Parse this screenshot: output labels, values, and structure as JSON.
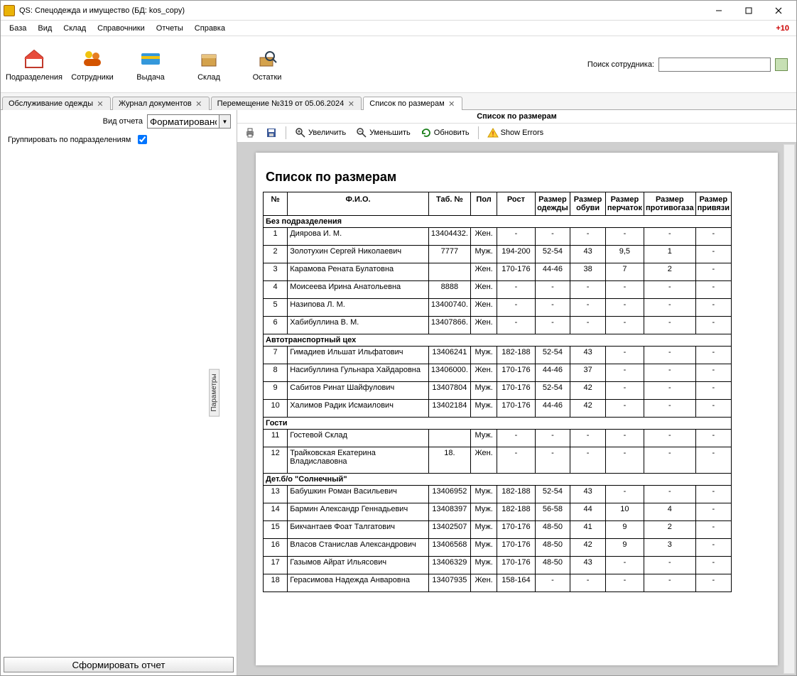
{
  "window": {
    "title": "QS: Спецодежда и имущество (БД: kos_copy)"
  },
  "menu": {
    "items": [
      "База",
      "Вид",
      "Склад",
      "Справочники",
      "Отчеты",
      "Справка"
    ],
    "right_status": "+10"
  },
  "main_toolbar": {
    "buttons": [
      {
        "name": "departments-button",
        "label": "Подразделения"
      },
      {
        "name": "employees-button",
        "label": "Сотрудники"
      },
      {
        "name": "issue-button",
        "label": "Выдача"
      },
      {
        "name": "stock-button",
        "label": "Склад"
      },
      {
        "name": "remains-button",
        "label": "Остатки"
      }
    ],
    "search_label": "Поиск сотрудника:"
  },
  "tabs": [
    {
      "label": "Обслуживание одежды",
      "active": false
    },
    {
      "label": "Журнал документов",
      "active": false
    },
    {
      "label": "Перемещение №319 от 05.06.2024",
      "active": false
    },
    {
      "label": "Список по размерам",
      "active": true
    }
  ],
  "left": {
    "report_type_label": "Вид отчета",
    "report_type_value": "Форматировано",
    "group_by_dept_label": "Группировать по подразделениям",
    "group_by_dept_checked": true,
    "params_handle": "Параметры",
    "run_button": "Сформировать отчет"
  },
  "report_toolbar": {
    "title": "Список по размерам",
    "zoom_in": "Увеличить",
    "zoom_out": "Уменьшить",
    "refresh": "Обновить",
    "show_errors": "Show Errors"
  },
  "report": {
    "heading": "Список по размерам",
    "columns": [
      "№",
      "Ф.И.О.",
      "Таб. №",
      "Пол",
      "Рост",
      "Размер одежды",
      "Размер обуви",
      "Размер перчаток",
      "Размер противогаза",
      "Размер привязи"
    ],
    "groups": [
      {
        "name": "Без подразделения",
        "rows": [
          {
            "n": "1",
            "fio": "Диярова И. М.",
            "tab": "13404432.",
            "sex": "Жен.",
            "height": "-",
            "cloth": "-",
            "shoe": "-",
            "glove": "-",
            "mask": "-",
            "harness": "-"
          },
          {
            "n": "2",
            "fio": "Золотухин Сергей Николаевич",
            "tab": "7777",
            "sex": "Муж.",
            "height": "194-200",
            "cloth": "52-54",
            "shoe": "43",
            "glove": "9,5",
            "mask": "1",
            "harness": "-"
          },
          {
            "n": "3",
            "fio": "Карамова Рената Булатовна",
            "tab": "",
            "sex": "Жен.",
            "height": "170-176",
            "cloth": "44-46",
            "shoe": "38",
            "glove": "7",
            "mask": "2",
            "harness": "-"
          },
          {
            "n": "4",
            "fio": "Моисеева Ирина Анатольевна",
            "tab": "8888",
            "sex": "Жен.",
            "height": "-",
            "cloth": "-",
            "shoe": "-",
            "glove": "-",
            "mask": "-",
            "harness": "-"
          },
          {
            "n": "5",
            "fio": "Назипова Л. М.",
            "tab": "13400740.",
            "sex": "Жен.",
            "height": "-",
            "cloth": "-",
            "shoe": "-",
            "glove": "-",
            "mask": "-",
            "harness": "-"
          },
          {
            "n": "6",
            "fio": "Хабибуллина В. М.",
            "tab": "13407866.",
            "sex": "Жен.",
            "height": "-",
            "cloth": "-",
            "shoe": "-",
            "glove": "-",
            "mask": "-",
            "harness": "-"
          }
        ]
      },
      {
        "name": "Автотранспортный цех",
        "rows": [
          {
            "n": "7",
            "fio": "Гимадиев Ильшат Ильфатович",
            "tab": "13406241",
            "sex": "Муж.",
            "height": "182-188",
            "cloth": "52-54",
            "shoe": "43",
            "glove": "-",
            "mask": "-",
            "harness": "-"
          },
          {
            "n": "8",
            "fio": "Насибуллина Гульнара Хайдаровна",
            "tab": "13406000.",
            "sex": "Жен.",
            "height": "170-176",
            "cloth": "44-46",
            "shoe": "37",
            "glove": "-",
            "mask": "-",
            "harness": "-"
          },
          {
            "n": "9",
            "fio": "Сабитов Ринат Шайфулович",
            "tab": "13407804",
            "sex": "Муж.",
            "height": "170-176",
            "cloth": "52-54",
            "shoe": "42",
            "glove": "-",
            "mask": "-",
            "harness": "-"
          },
          {
            "n": "10",
            "fio": "Халимов Радик Исмаилович",
            "tab": "13402184",
            "sex": "Муж.",
            "height": "170-176",
            "cloth": "44-46",
            "shoe": "42",
            "glove": "-",
            "mask": "-",
            "harness": "-"
          }
        ]
      },
      {
        "name": "Гости",
        "rows": [
          {
            "n": "11",
            "fio": "Гостевой Склад",
            "tab": "",
            "sex": "Муж.",
            "height": "-",
            "cloth": "-",
            "shoe": "-",
            "glove": "-",
            "mask": "-",
            "harness": "-"
          },
          {
            "n": "12",
            "fio": "Трайковская Екатерина Владиславовна",
            "tab": "18.",
            "sex": "Жен.",
            "height": "-",
            "cloth": "-",
            "shoe": "-",
            "glove": "-",
            "mask": "-",
            "harness": "-"
          }
        ]
      },
      {
        "name": "Дет.б/о \"Солнечный\"",
        "rows": [
          {
            "n": "13",
            "fio": "Бабушкин Роман Васильевич",
            "tab": "13406952",
            "sex": "Муж.",
            "height": "182-188",
            "cloth": "52-54",
            "shoe": "43",
            "glove": "-",
            "mask": "-",
            "harness": "-"
          },
          {
            "n": "14",
            "fio": "Бармин Александр Геннадьевич",
            "tab": "13408397",
            "sex": "Муж.",
            "height": "182-188",
            "cloth": "56-58",
            "shoe": "44",
            "glove": "10",
            "mask": "4",
            "harness": "-"
          },
          {
            "n": "15",
            "fio": "Бикчантаев Фоат Талгатович",
            "tab": "13402507",
            "sex": "Муж.",
            "height": "170-176",
            "cloth": "48-50",
            "shoe": "41",
            "glove": "9",
            "mask": "2",
            "harness": "-"
          },
          {
            "n": "16",
            "fio": "Власов Станислав Александрович",
            "tab": "13406568",
            "sex": "Муж.",
            "height": "170-176",
            "cloth": "48-50",
            "shoe": "42",
            "glove": "9",
            "mask": "3",
            "harness": "-"
          },
          {
            "n": "17",
            "fio": "Газымов Айрат Ильясович",
            "tab": "13406329",
            "sex": "Муж.",
            "height": "170-176",
            "cloth": "48-50",
            "shoe": "43",
            "glove": "-",
            "mask": "-",
            "harness": "-"
          },
          {
            "n": "18",
            "fio": "Герасимова Надежда Анваровна",
            "tab": "13407935",
            "sex": "Жен.",
            "height": "158-164",
            "cloth": "-",
            "shoe": "-",
            "glove": "-",
            "mask": "-",
            "harness": "-"
          }
        ]
      }
    ]
  }
}
